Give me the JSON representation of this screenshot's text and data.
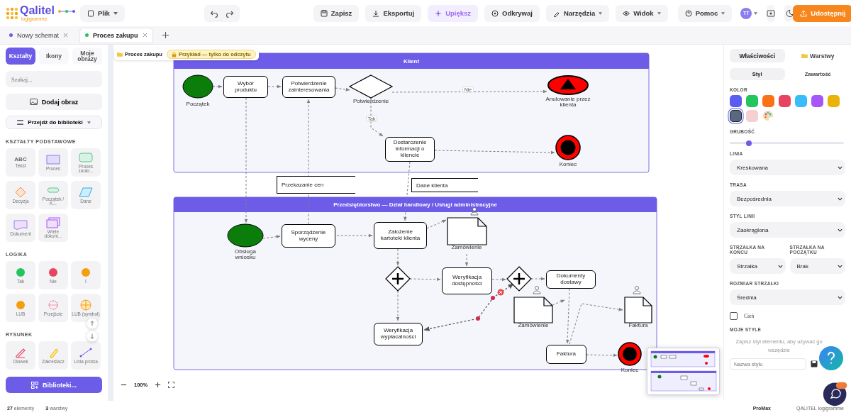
{
  "header": {
    "logo": "Qalitel",
    "subtitle": "logigramme",
    "file_menu": "Plik",
    "actions": [
      {
        "kind": "save",
        "label": "Zapisz",
        "dropdown": false
      },
      {
        "kind": "export",
        "label": "Eksportuj",
        "dropdown": false
      },
      {
        "kind": "beautify",
        "label": "Upiększ",
        "dropdown": false
      },
      {
        "kind": "explore",
        "label": "Odkrywaj",
        "dropdown": false
      },
      {
        "kind": "tools",
        "label": "Narzędzia",
        "dropdown": true
      },
      {
        "kind": "view",
        "label": "Widok",
        "dropdown": true
      },
      {
        "kind": "help",
        "label": "Pomoc",
        "dropdown": true
      }
    ],
    "avatar": "TT",
    "share": "Udostępnij"
  },
  "document_tabs": [
    {
      "label": "Nowy schemat",
      "selected": false,
      "color": "#6c5ce7"
    },
    {
      "label": "Proces zakupu",
      "selected": true,
      "color": "#22c55e"
    }
  ],
  "sidebar": {
    "tabs": [
      {
        "label": "Kształty",
        "selected": true
      },
      {
        "label": "Ikony",
        "selected": false
      },
      {
        "label": "Moje obrazy",
        "selected": false
      }
    ],
    "search": {
      "placeholder": "Szukaj..."
    },
    "add_image": "Dodaj obraz",
    "library_menu": "Przejdź do biblioteki",
    "sections": [
      {
        "title": "KSZTAŁTY PODSTAWOWE",
        "items": [
          {
            "kind": "text",
            "label": "Tekst",
            "sample": "ABC"
          },
          {
            "kind": "rect",
            "label": "Proces"
          },
          {
            "kind": "rounded",
            "label": "Proces zaokr..."
          },
          {
            "kind": "diamond",
            "label": "Decyzja"
          },
          {
            "kind": "terminal",
            "label": "Początek / K..."
          },
          {
            "kind": "data",
            "label": "Dane"
          },
          {
            "kind": "document",
            "label": "Dokument"
          },
          {
            "kind": "multidoc",
            "label": "Wiele dokum..."
          }
        ]
      },
      {
        "title": "LOGIKA",
        "items": [
          {
            "kind": "and",
            "label": "Tak"
          },
          {
            "kind": "not",
            "label": "Nie"
          },
          {
            "kind": "i",
            "label": "I"
          },
          {
            "kind": "or",
            "label": "LUB"
          },
          {
            "kind": "junction",
            "label": "Przejście"
          },
          {
            "kind": "or_symbol",
            "label": "LUB (symbol)"
          }
        ]
      },
      {
        "title": "RYSUNEK",
        "items": [
          {
            "kind": "pencil",
            "label": "Ołówek"
          },
          {
            "kind": "highlighter",
            "label": "Zakreślacz"
          },
          {
            "kind": "line",
            "label": "Linia prosta"
          }
        ]
      }
    ],
    "libraries_button": "Biblioteki..."
  },
  "canvas": {
    "breadcrumb": "Proces zakupu",
    "badge": "Przykład — tylko do odczytu",
    "pools": [
      {
        "title": "Klient"
      },
      {
        "title": "Przedsiębiorstwo — Dział handlowy / Usługi administracyjne"
      }
    ],
    "nodes": [
      {
        "kind": "start",
        "label": "Początek"
      },
      {
        "kind": "task",
        "label": "Wybór produktu"
      },
      {
        "kind": "task",
        "label": "Potwierdzenie zainteresowania"
      },
      {
        "kind": "gateway",
        "label": "Potwierdzenie"
      },
      {
        "kind": "cancel",
        "label": "Anulowanie przez klienta"
      },
      {
        "kind": "task",
        "label": "Dostarczenie informacji o kliencie"
      },
      {
        "kind": "end",
        "label": "Koniec"
      },
      {
        "kind": "start",
        "label": "Obsługa wniosku"
      },
      {
        "kind": "task",
        "label": "Sporządzenie wyceny"
      },
      {
        "kind": "task",
        "label": "Założenie kartoteki klienta"
      },
      {
        "kind": "document",
        "label": "Zamówienie"
      },
      {
        "kind": "parallel"
      },
      {
        "kind": "task",
        "label": "Weryfikacja dostępności"
      },
      {
        "kind": "parallel"
      },
      {
        "kind": "task",
        "label": "Dokumenty dostawy"
      },
      {
        "kind": "document",
        "label": "Zamówienie"
      },
      {
        "kind": "document",
        "label": "Faktura"
      },
      {
        "kind": "task",
        "label": "Weryfikacja wypłacalności"
      },
      {
        "kind": "task",
        "label": "Faktura"
      },
      {
        "kind": "end",
        "label": "Koniec"
      }
    ],
    "edge_labels": [
      "Nie",
      "Tak"
    ],
    "annotations": [
      "Przekazanie cen",
      "Dane klienta"
    ],
    "zoom": "100%"
  },
  "properties": {
    "tabs": [
      {
        "label": "Właściwości",
        "selected": true
      },
      {
        "label": "Warstwy",
        "selected": false
      }
    ],
    "subtabs": [
      {
        "label": "Styl",
        "selected": true
      },
      {
        "label": "Zawartość",
        "selected": false
      }
    ],
    "color_label": "KOLOR",
    "swatches": [
      {
        "color": "#5b5cf0",
        "selected": false
      },
      {
        "color": "#22c55e",
        "selected": false
      },
      {
        "color": "#f97316",
        "selected": false
      },
      {
        "color": "#e8435f",
        "selected": false
      },
      {
        "color": "#38bdf8",
        "selected": false
      },
      {
        "color": "#a855f7",
        "selected": false
      },
      {
        "color": "#eab308",
        "selected": false
      },
      {
        "color": "#5a6781",
        "selected": true
      },
      {
        "color": "#f6cfd0",
        "selected": false
      }
    ],
    "thickness": {
      "label": "GRUBOŚĆ",
      "level": 0.17
    },
    "fields": [
      {
        "label": "LINIA",
        "value": "Kreskowana"
      },
      {
        "label": "TRASA",
        "value": "Bezpośrednia"
      },
      {
        "label": "STYL LINII",
        "value": "Zaokrąglona"
      }
    ],
    "arrow_ends": [
      {
        "label": "STRZAŁKA NA KOŃCU",
        "value": "Strzałka"
      },
      {
        "label": "STRZAŁKA NA POCZĄTKU",
        "value": "Brak"
      }
    ],
    "arrow_size": {
      "label": "ROZMIAR STRZAŁKI",
      "value": "Średnia"
    },
    "shadow": {
      "label": "Cień",
      "checked": false
    },
    "my_styles": {
      "title": "MOJE STYLE",
      "hint": "Zapisz styl elementu, aby używać go wszędzie",
      "placeholder": "Nazwa stylu"
    }
  },
  "status_bar": {
    "elements_count": "27",
    "elements_label": "elementy",
    "layers_count": "3",
    "layers_label": "warstwy",
    "plan": "ProMax",
    "brand": "QALITEL logigramme"
  }
}
